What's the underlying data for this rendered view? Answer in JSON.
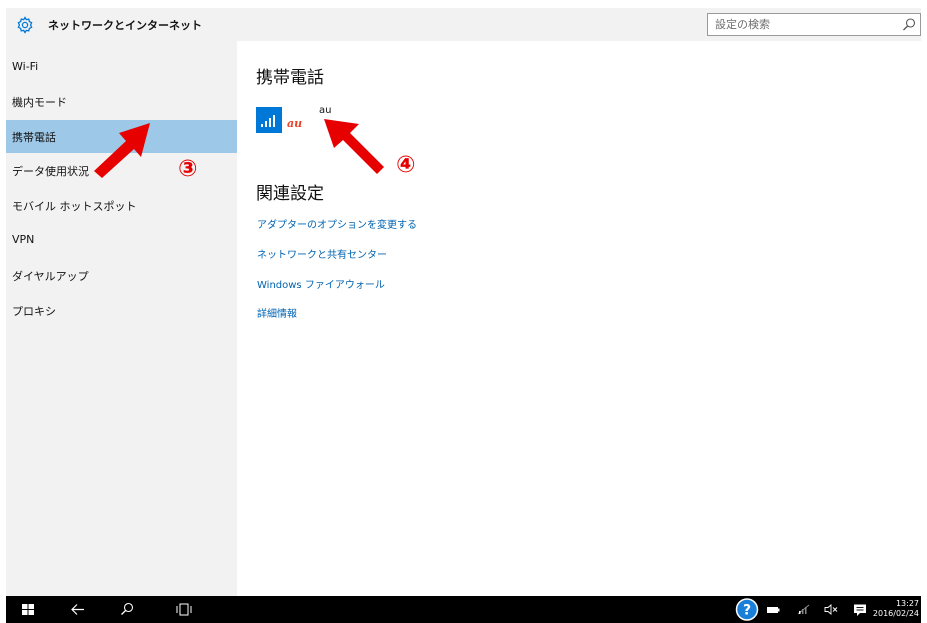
{
  "window": {
    "title": "ネットワークとインターネット",
    "gear_icon": "gear-icon"
  },
  "search": {
    "placeholder": "設定の検索",
    "icon": "search-icon"
  },
  "sidebar": {
    "items": [
      {
        "label": "Wi-Fi",
        "selected": false
      },
      {
        "label": "機内モード",
        "selected": false
      },
      {
        "label": "携帯電話",
        "selected": true
      },
      {
        "label": "データ使用状況",
        "selected": false
      },
      {
        "label": "モバイル ホットスポット",
        "selected": false
      },
      {
        "label": "VPN",
        "selected": false
      },
      {
        "label": "ダイヤルアップ",
        "selected": false
      },
      {
        "label": "プロキシ",
        "selected": false
      }
    ]
  },
  "main": {
    "heading": "携帯電話",
    "connection": {
      "logo_text": "au",
      "carrier": "au",
      "signal_icon": "signal-bars-icon"
    },
    "related_heading": "関連設定",
    "related_links": [
      "アダプターのオプションを変更する",
      "ネットワークと共有センター",
      "Windows ファイアウォール",
      "詳細情報"
    ]
  },
  "annotations": {
    "step_3": "③",
    "step_4": "④",
    "arrow_color": "#e60000"
  },
  "taskbar": {
    "time": "13:27",
    "date": "2016/02/24",
    "icons": [
      "windows-start-icon",
      "back-arrow-icon",
      "search-icon",
      "task-view-icon",
      "help-icon",
      "battery-icon",
      "cellular-icon",
      "volume-muted-icon",
      "action-center-icon"
    ]
  },
  "colors": {
    "accent": "#0078d7",
    "selection": "#9ec8e8",
    "link": "#0063b1",
    "annotation": "#e60000"
  }
}
